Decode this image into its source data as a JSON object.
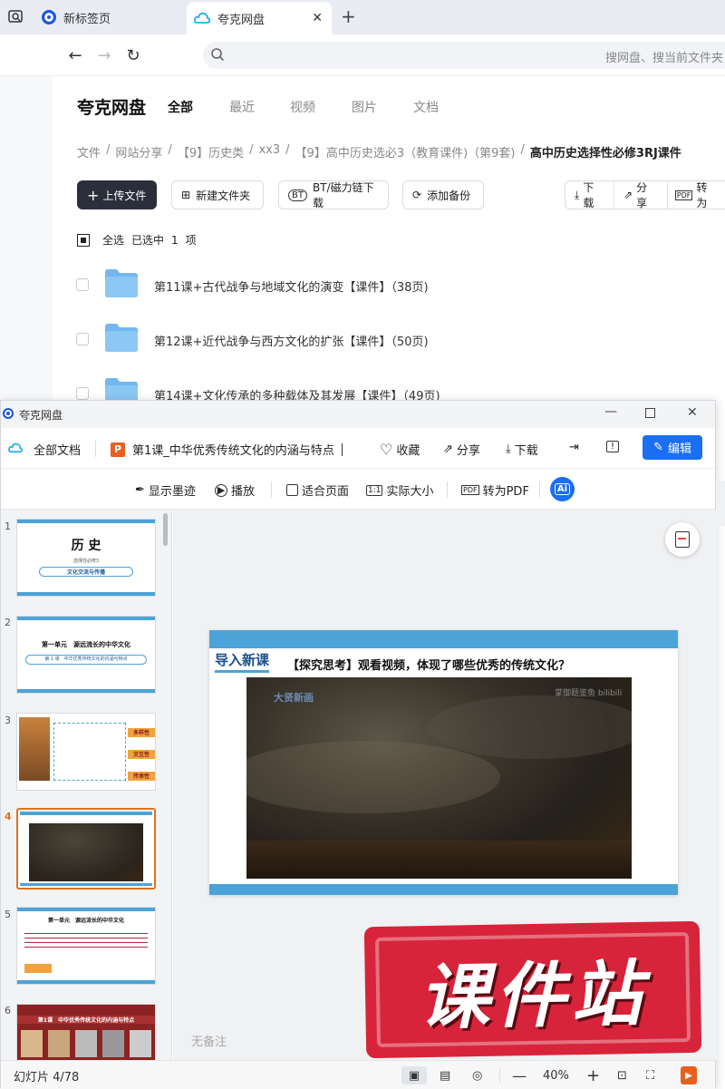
{
  "browser": {
    "tabs": [
      {
        "label": "新标签页"
      },
      {
        "label": "夸克网盘"
      }
    ],
    "address_placeholder": "搜网盘、搜当前文件夹"
  },
  "page": {
    "logo": "夸克网盘",
    "menu": [
      "全部",
      "最近",
      "视频",
      "图片",
      "文档"
    ],
    "breadcrumb": [
      "文件",
      "网站分享",
      "【9】历史类",
      "xx3",
      "【9】高中历史选必3（教育课件)（第9套)",
      "高中历史选择性必修3RJ课件"
    ],
    "breadcrumb_sep": "/",
    "buttons": {
      "upload": "上传文件",
      "new_folder": "新建文件夹",
      "bt": "BT/磁力链下载",
      "backup": "添加备份",
      "download": "下载",
      "share": "分享",
      "convert": "转为"
    },
    "selection": {
      "select_all": "全选",
      "selected_prefix": "已选中",
      "count": "1",
      "unit": "项"
    },
    "files": [
      {
        "name": "第11课+古代战争与地域文化的演变【课件】（38页)"
      },
      {
        "name": "第12课+近代战争与西方文化的扩张【课件】（50页)"
      },
      {
        "name": "第14课+文化传承的多种载体及其发展【课件】（49页)"
      }
    ]
  },
  "viewer": {
    "window_title": "夸克网盘",
    "all_docs": "全部文档",
    "doc_badge": "P",
    "doc_title": "第1课_中华优秀传统文化的内涵与特点",
    "favorite": "收藏",
    "share": "分享",
    "download": "下载",
    "edit": "编辑",
    "tools": {
      "ink": "显示墨迹",
      "play": "播放",
      "fit": "适合页面",
      "actual": "实际大小",
      "pdf": "转为PDF",
      "ai": "Ai"
    },
    "thumbnails": [
      {
        "num": "1",
        "title": "历 史",
        "sub1": "选择性必修3",
        "sub2": "文化交流与传播"
      },
      {
        "num": "2",
        "title": "第一单元　源远流长的中华文化",
        "sub1": "第 1 课　中华优秀传统文化的内涵与特点"
      },
      {
        "num": "3",
        "tags": [
          "多样性",
          "交互性",
          "传承性"
        ]
      },
      {
        "num": "4"
      },
      {
        "num": "5",
        "title": "第一单元　源远流长的中华文化"
      },
      {
        "num": "6",
        "title": "第1课　中华优秀传统文化的内涵与特点"
      }
    ],
    "slide": {
      "section": "导入新课",
      "question": "【探究思考】观看视频，体现了哪些优秀的传统文化？",
      "video_logo_left": "大贤新画",
      "video_logo_right": "掌御题鉴鱼 bilibili"
    },
    "stamp": "课件站",
    "notes": "无备注",
    "status": {
      "slide_counter": "幻灯片 4/78",
      "zoom": "40%"
    }
  },
  "colors": {
    "accent": "#1a6ff2",
    "upload_button": "#2b2f3c",
    "slide_bar": "#4ba3d8",
    "stamp": "#d7243a",
    "selected_border": "#e0721a"
  }
}
